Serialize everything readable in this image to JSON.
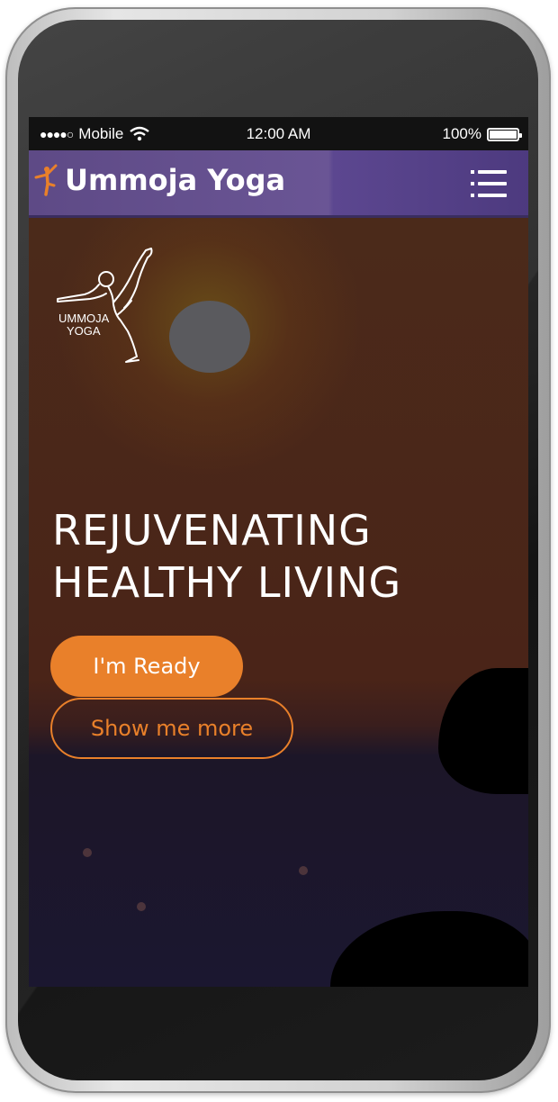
{
  "status_bar": {
    "signal": "●●●●○",
    "carrier": "Mobile",
    "time": "12:00 AM",
    "battery": "100%"
  },
  "header": {
    "title": "Ummoja Yoga",
    "menu_icon": "hamburger-menu-icon",
    "logo_icon": "yoga-pose-icon",
    "accent_color": "#e9802a",
    "bar_color": "#5e4a86"
  },
  "hero": {
    "logo_line1": "UMMOJA",
    "logo_line2": "YOGA",
    "headline_line1": "REJUVENATING",
    "headline_line2": "HEALTHY LIVING",
    "primary_button": "I'm Ready",
    "secondary_button": "Show me more"
  }
}
